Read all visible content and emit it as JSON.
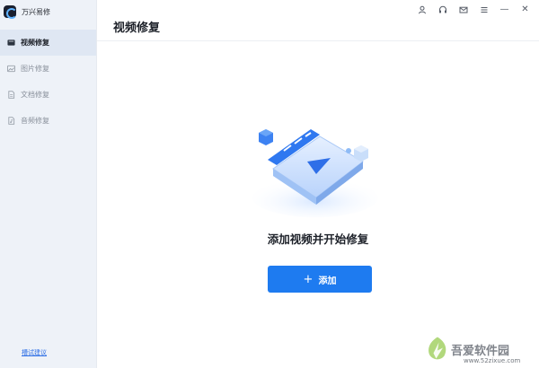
{
  "app": {
    "name": "万兴易修"
  },
  "titlebar": {
    "icons": [
      "user-icon",
      "headset-icon",
      "mail-icon",
      "menu-icon",
      "minimize-icon",
      "close-icon"
    ],
    "minimize_glyph": "—",
    "close_glyph": "✕"
  },
  "sidebar": {
    "items": [
      {
        "label": "视频修复",
        "icon": "video-icon",
        "active": true
      },
      {
        "label": "图片修复",
        "icon": "image-icon",
        "active": false
      },
      {
        "label": "文档修复",
        "icon": "document-icon",
        "active": false
      },
      {
        "label": "音频修复",
        "icon": "audio-icon",
        "active": false
      }
    ],
    "feedback_label": "槽试建议"
  },
  "main": {
    "title": "视频修复",
    "empty_message": "添加视频并开始修复",
    "add_button_label": "添加",
    "add_button_glyph": "+"
  },
  "watermark": {
    "brand": "吾爱软件园",
    "url": "www.52zixue.com"
  },
  "colors": {
    "accent": "#1e7bf0",
    "sidebar_bg": "#eef2f8",
    "sidebar_active": "#dfe7f3",
    "link": "#2b6de5"
  }
}
